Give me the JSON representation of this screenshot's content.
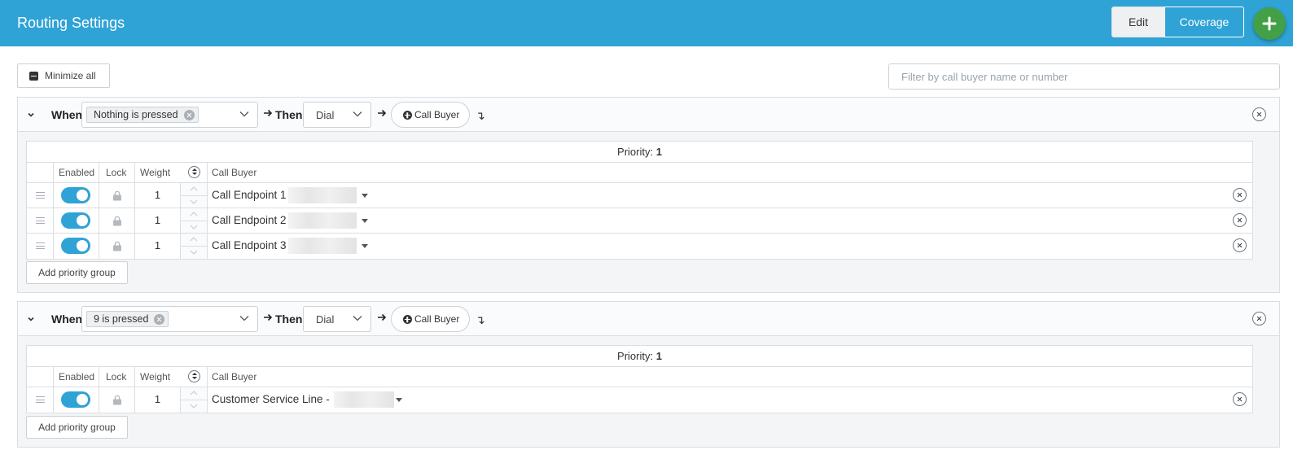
{
  "header": {
    "title": "Routing Settings",
    "edit_label": "Edit",
    "coverage_label": "Coverage",
    "add_icon": "plus-icon",
    "bar_color": "#2fa3d6",
    "add_color": "#43a047"
  },
  "toolbar": {
    "minimize_label": "Minimize all",
    "filter_placeholder": "Filter by call buyer name or number"
  },
  "columns": {
    "enabled": "Enabled",
    "lock": "Lock",
    "weight": "Weight",
    "call_buyer": "Call Buyer"
  },
  "rules": [
    {
      "when_label": "When",
      "condition": "Nothing is pressed",
      "then_label": "Then",
      "action": "Dial",
      "call_buyer_button": "Call Buyer",
      "priority_label": "Priority:",
      "priority": "1",
      "rows": [
        {
          "enabled": true,
          "locked": true,
          "weight": "1",
          "buyer": "Call Endpoint 1"
        },
        {
          "enabled": true,
          "locked": true,
          "weight": "1",
          "buyer": "Call Endpoint 2"
        },
        {
          "enabled": true,
          "locked": true,
          "weight": "1",
          "buyer": "Call Endpoint 3"
        }
      ],
      "add_priority_label": "Add priority group"
    },
    {
      "when_label": "When",
      "condition": "9 is pressed",
      "then_label": "Then",
      "action": "Dial",
      "call_buyer_button": "Call Buyer",
      "priority_label": "Priority:",
      "priority": "1",
      "rows": [
        {
          "enabled": true,
          "locked": true,
          "weight": "1",
          "buyer": "Customer Service Line -"
        }
      ],
      "add_priority_label": "Add priority group"
    }
  ]
}
